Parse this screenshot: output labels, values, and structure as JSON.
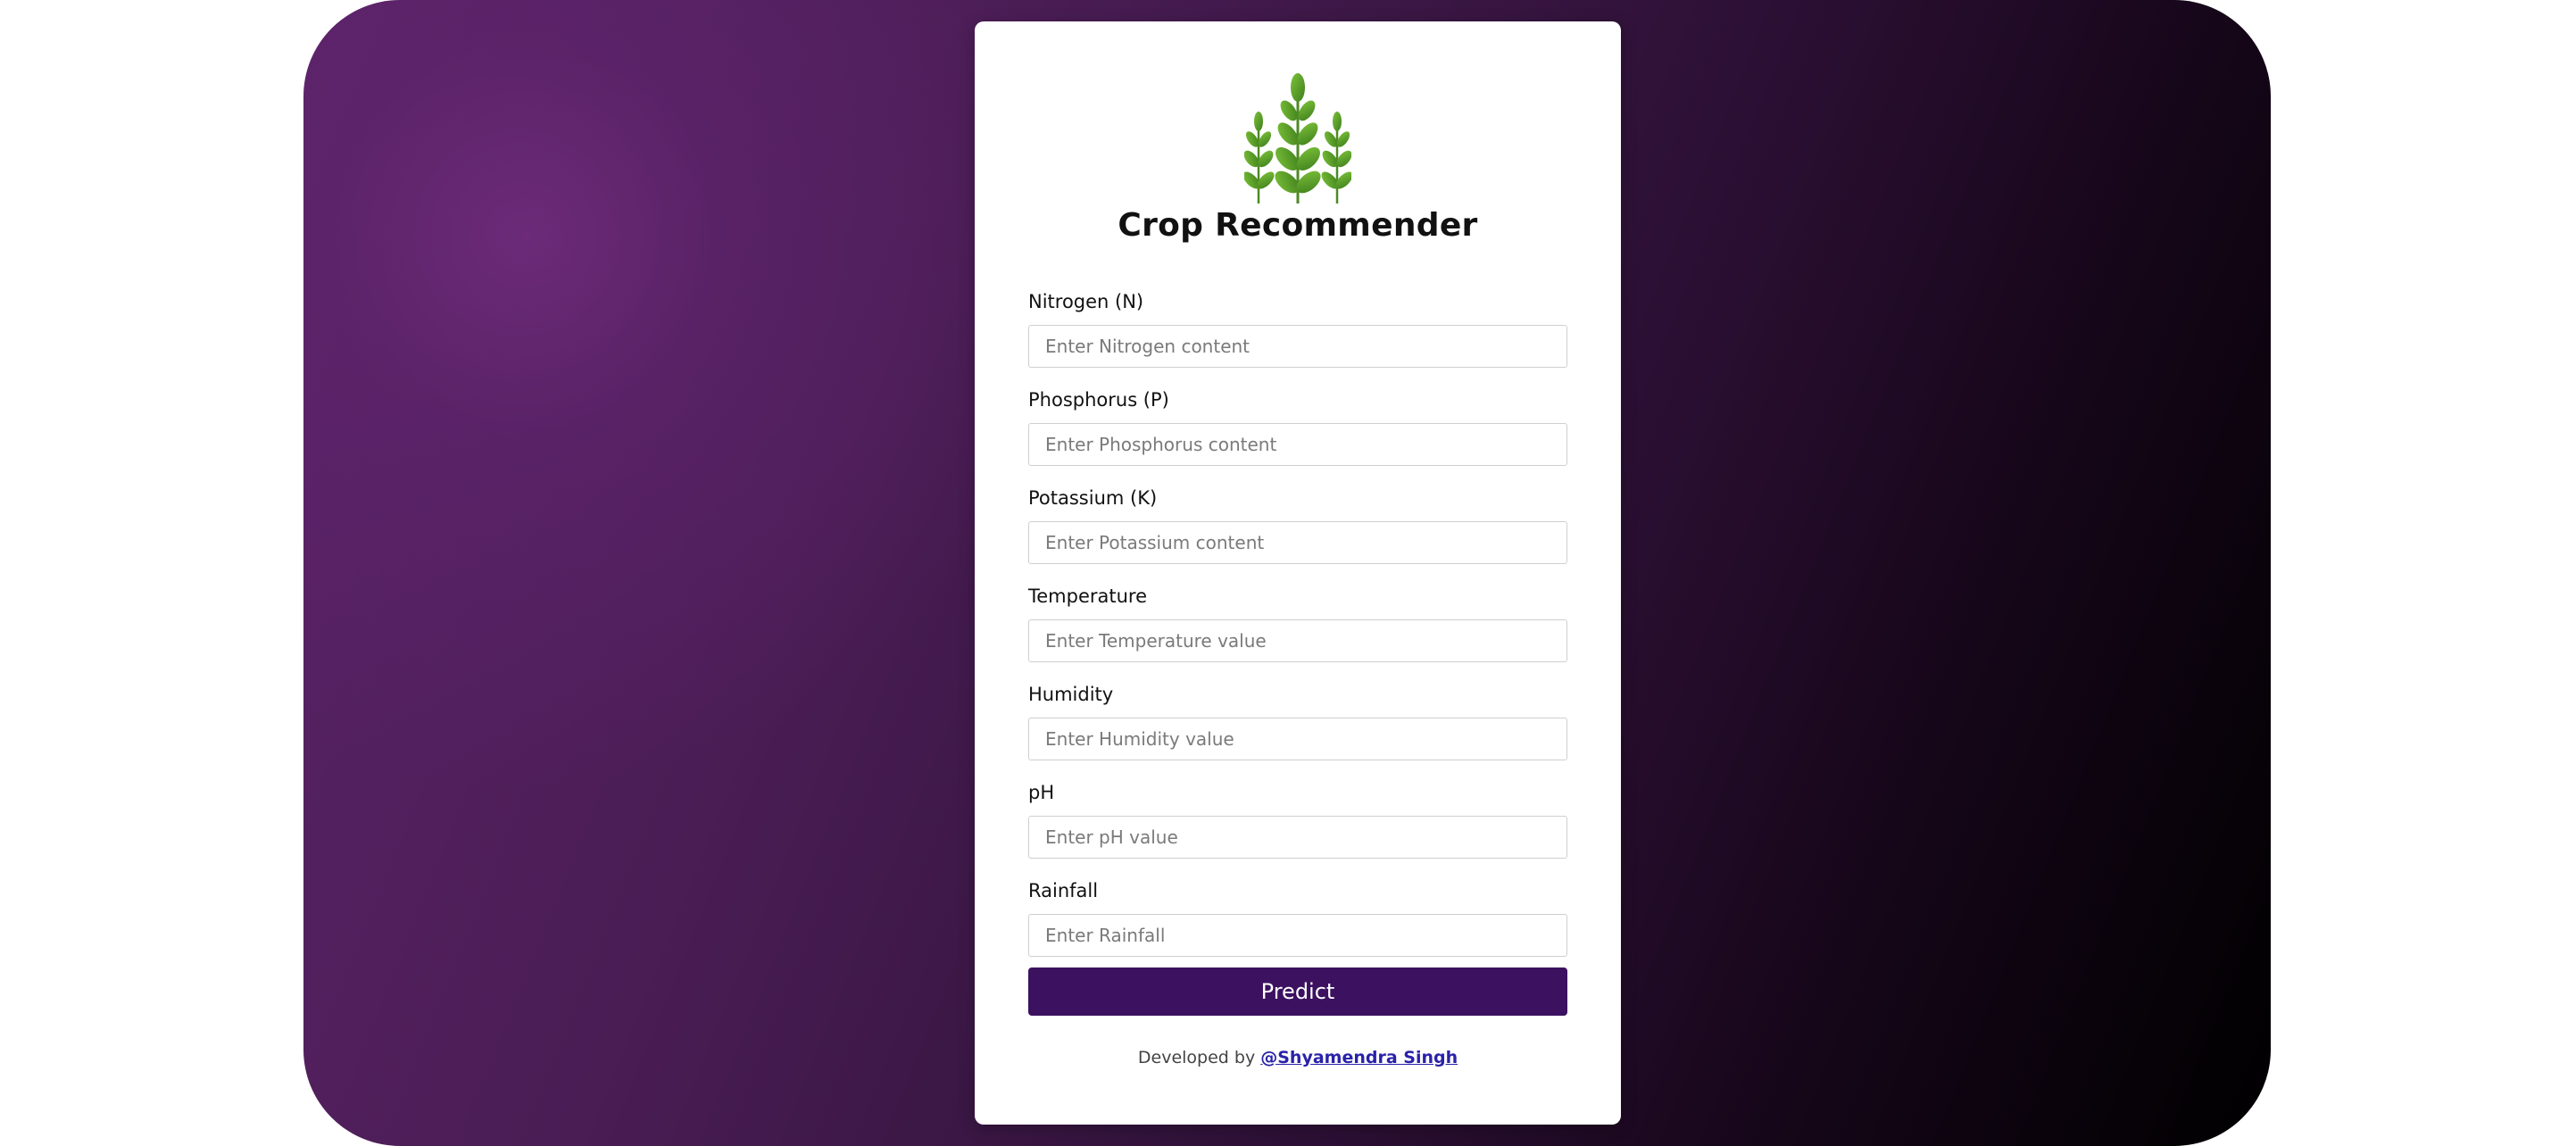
{
  "app": {
    "title": "Crop Recommender",
    "logo_icon": "wheat-plant-icon",
    "colors": {
      "background_start": "#5b2368",
      "background_end": "#000000",
      "button": "#3b1160",
      "link": "#2a22a8",
      "logo_green": "#5ea12a"
    }
  },
  "form": {
    "fields": [
      {
        "label": "Nitrogen (N)",
        "placeholder": "Enter Nitrogen content",
        "value": ""
      },
      {
        "label": "Phosphorus (P)",
        "placeholder": "Enter Phosphorus content",
        "value": ""
      },
      {
        "label": "Potassium (K)",
        "placeholder": "Enter Potassium content",
        "value": ""
      },
      {
        "label": "Temperature",
        "placeholder": "Enter Temperature value",
        "value": ""
      },
      {
        "label": "Humidity",
        "placeholder": "Enter Humidity value",
        "value": ""
      },
      {
        "label": "pH",
        "placeholder": "Enter pH value",
        "value": ""
      },
      {
        "label": "Rainfall",
        "placeholder": "Enter Rainfall",
        "value": ""
      }
    ],
    "submit_label": "Predict"
  },
  "footer": {
    "prefix": "Developed by",
    "author_link": "@Shyamendra Singh"
  }
}
